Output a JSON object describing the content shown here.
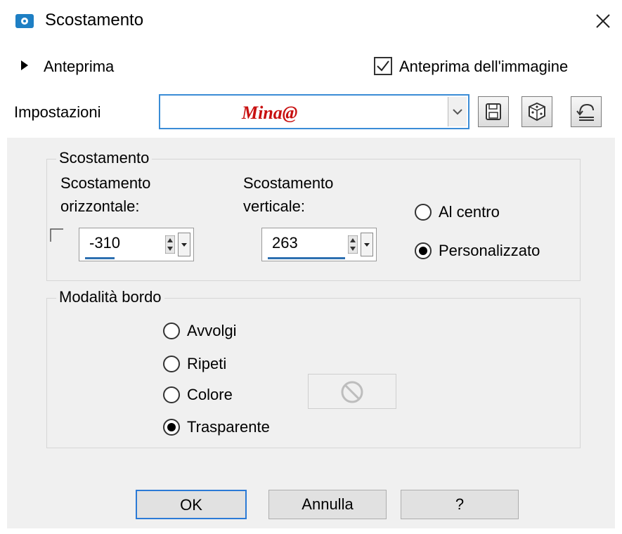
{
  "window": {
    "title": "Scostamento",
    "icon": "camera-icon"
  },
  "header": {
    "preview_label": "Anteprima",
    "image_preview_label": "Anteprima dell'immagine",
    "image_preview_checked": true
  },
  "settings": {
    "label": "Impostazioni",
    "preset_value": "Mina@",
    "buttons": [
      "save-icon",
      "dice-icon",
      "reset-icon"
    ]
  },
  "offset_group": {
    "title": "Scostamento",
    "horizontal_label_1": "Scostamento",
    "horizontal_label_2": "orizzontale:",
    "horizontal_value": "-310",
    "vertical_label_1": "Scostamento",
    "vertical_label_2": "verticale:",
    "vertical_value": "263",
    "options": [
      "Al centro",
      "Personalizzato"
    ],
    "selected": "Personalizzato"
  },
  "edge_group": {
    "title": "Modalità bordo",
    "options": [
      "Avvolgi",
      "Ripeti",
      "Colore",
      "Trasparente"
    ],
    "selected": "Trasparente"
  },
  "footer": {
    "ok": "OK",
    "cancel": "Annulla",
    "help": "?"
  },
  "colors": {
    "accent": "#2b7ad6",
    "preset_text": "#c81010",
    "panel": "#f0f0f0"
  }
}
